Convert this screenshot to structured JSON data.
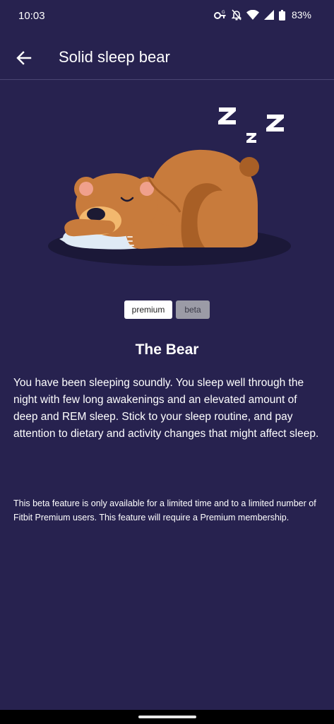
{
  "status_bar": {
    "time": "10:03",
    "battery": "83%",
    "icons": [
      "key-icon",
      "bell-off-icon",
      "wifi-icon",
      "signal-icon",
      "battery-icon"
    ]
  },
  "header": {
    "title": "Solid sleep bear",
    "back_icon": "arrow-left-icon"
  },
  "illustration": {
    "subject": "sleeping-bear",
    "zzz": [
      "Z",
      "z",
      "Z"
    ],
    "colors": {
      "fur": "#c87b3c",
      "fur_dark": "#a85f26",
      "ear_inner": "#f0a08c",
      "muzzle": "#f2b86e",
      "pillow": "#dfeaf5",
      "shadow": "#1b1838"
    }
  },
  "badges": {
    "premium": "premium",
    "beta": "beta"
  },
  "content": {
    "title": "The Bear",
    "description": "You have been sleeping soundly. You sleep well through the night with few long awakenings and an elevated amount of deep and REM sleep. Stick to your sleep routine, and pay attention to dietary and activity changes that might affect sleep.",
    "disclaimer": "This beta feature is only available for a limited time and to a limited number of Fitbit Premium users. This feature will require a Premium membership."
  },
  "colors": {
    "background": "#27224f",
    "text": "#ffffff",
    "divider": "#4a4572"
  }
}
